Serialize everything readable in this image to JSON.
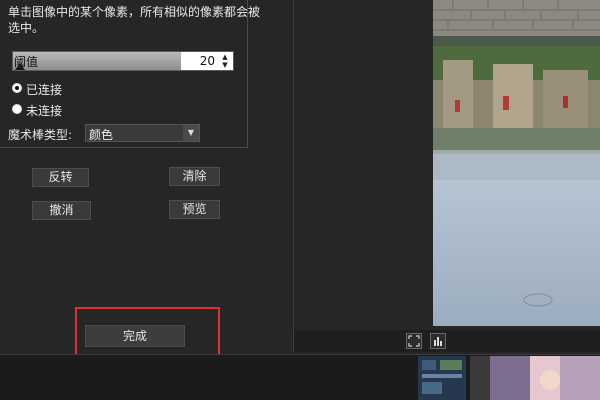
{
  "panel": {
    "instruction": "单击图像中的某个像素，所有相似的像素都会被选中。",
    "threshold": {
      "label": "阈值",
      "value": "20",
      "level": 0.2
    },
    "connectivity": {
      "options": [
        "已连接",
        "未连接"
      ],
      "selected": "已连接"
    },
    "wand_type": {
      "label": "魔术棒类型:",
      "value": "颜色"
    }
  },
  "buttons": {
    "invert": "反转",
    "clear": "清除",
    "undo": "撤消",
    "preview": "预览",
    "done": "完成"
  },
  "icons": {
    "fit": "fit-screen-icon",
    "histogram": "histogram-icon",
    "spin": "spin-arrows-icon",
    "dropdown": "chevron-down-icon"
  },
  "colors": {
    "background": "#262626",
    "button": "#3a3a3a",
    "highlight": "#e03131"
  }
}
